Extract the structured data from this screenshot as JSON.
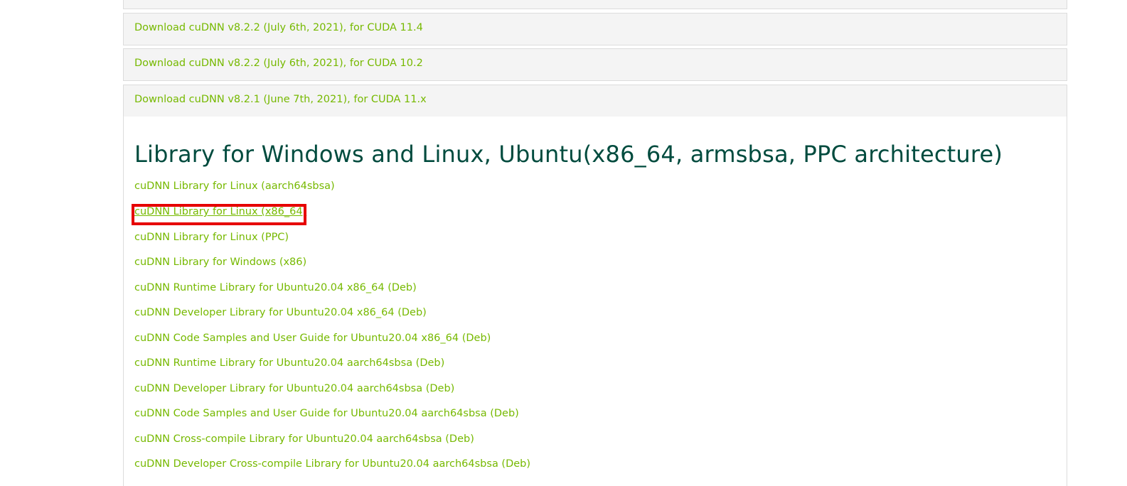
{
  "accordion": [
    {
      "label": ""
    },
    {
      "label": "Download cuDNN v8.2.2 (July 6th, 2021), for CUDA 11.4"
    },
    {
      "label": "Download cuDNN v8.2.2 (July 6th, 2021), for CUDA 10.2"
    },
    {
      "label": "Download cuDNN v8.2.1 (June 7th, 2021), for CUDA 11.x"
    }
  ],
  "panel": {
    "heading": "Library for Windows and Linux, Ubuntu(x86_64, armsbsa, PPC architecture)",
    "links": [
      "cuDNN Library for Linux (aarch64sbsa)",
      "cuDNN Library for Linux (x86_64)",
      "cuDNN Library for Linux (PPC)",
      "cuDNN Library for Windows (x86)",
      "cuDNN Runtime Library for Ubuntu20.04 x86_64 (Deb)",
      "cuDNN Developer Library for Ubuntu20.04 x86_64 (Deb)",
      "cuDNN Code Samples and User Guide for Ubuntu20.04 x86_64 (Deb)",
      "cuDNN Runtime Library for Ubuntu20.04 aarch64sbsa (Deb)",
      "cuDNN Developer Library for Ubuntu20.04 aarch64sbsa (Deb)",
      "cuDNN Code Samples and User Guide for Ubuntu20.04 aarch64sbsa (Deb)",
      "cuDNN Cross-compile Library for Ubuntu20.04 aarch64sbsa (Deb)",
      "cuDNN Developer Cross-compile Library for Ubuntu20.04 aarch64sbsa (Deb)"
    ]
  },
  "colors": {
    "link": "#76b900",
    "heading": "#004b3e",
    "highlight": "#e60000",
    "row_bg": "#f4f4f4"
  }
}
